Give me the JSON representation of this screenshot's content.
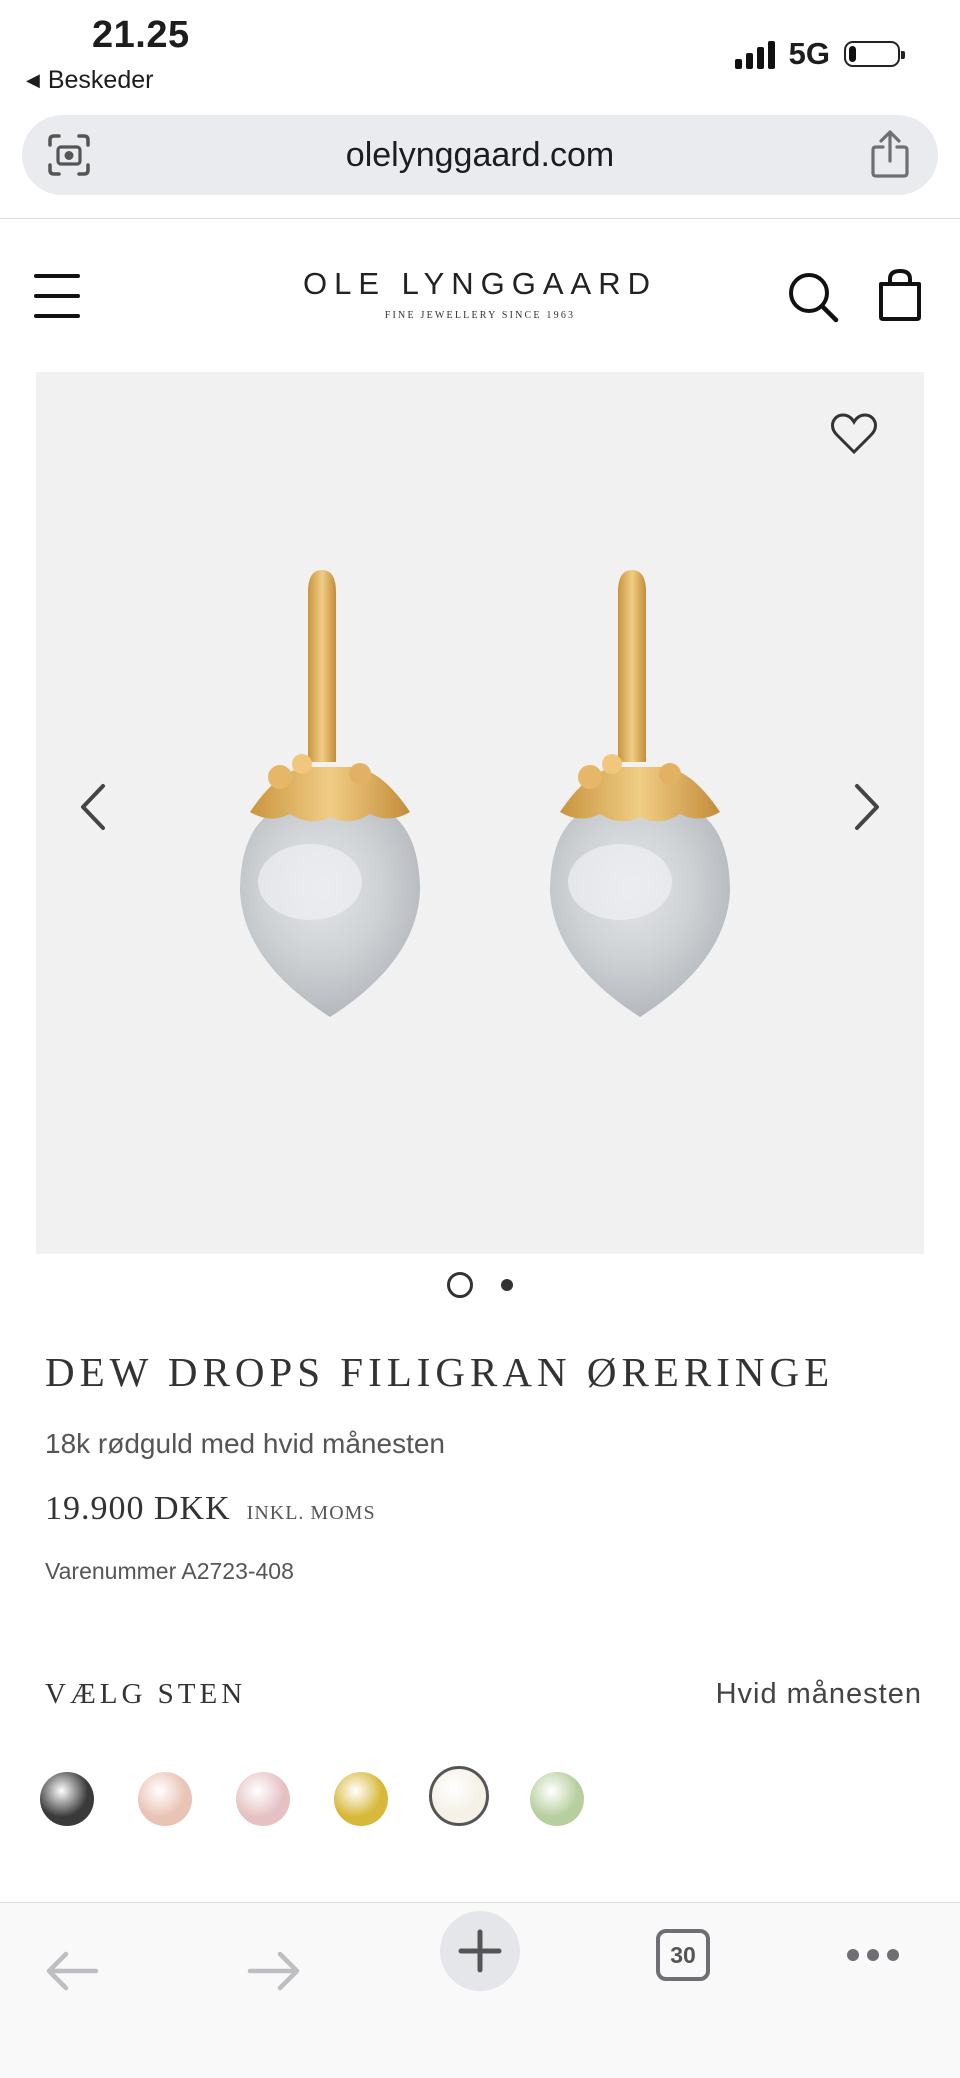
{
  "status_bar": {
    "time": "21.25",
    "back_app": "Beskeder",
    "network": "5G",
    "battery_level": 0.15
  },
  "browser": {
    "url": "olelynggaard.com"
  },
  "site_header": {
    "brand_name": "OLE LYNGGAARD",
    "brand_tagline": "FINE JEWELLERY SINCE 1963"
  },
  "gallery": {
    "image_count": 2,
    "current_image": 1
  },
  "product": {
    "title": "DEW DROPS FILIGRAN ØRERINGE",
    "subtitle": "18k rødguld med hvid månesten",
    "price": "19.900 DKK",
    "vat_note": "INKL. MOMS",
    "sku": "Varenummer A2723-408"
  },
  "stone_selector": {
    "label": "VÆLG STEN",
    "selected_value": "Hvid månesten",
    "options": [
      {
        "icon": "black-stone-swatch",
        "color": "#3a3a3a"
      },
      {
        "icon": "peach-stone-swatch",
        "color": "#e9c3b3"
      },
      {
        "icon": "pink-stone-swatch",
        "color": "#e6c1c4"
      },
      {
        "icon": "yellow-stone-swatch",
        "color": "#d8b83a"
      },
      {
        "icon": "white-moonstone-swatch",
        "color": "#f5f1e6",
        "selected": true
      },
      {
        "icon": "green-stone-swatch",
        "color": "#b7cf9f"
      }
    ]
  },
  "toolbar": {
    "tab_count": "30"
  }
}
